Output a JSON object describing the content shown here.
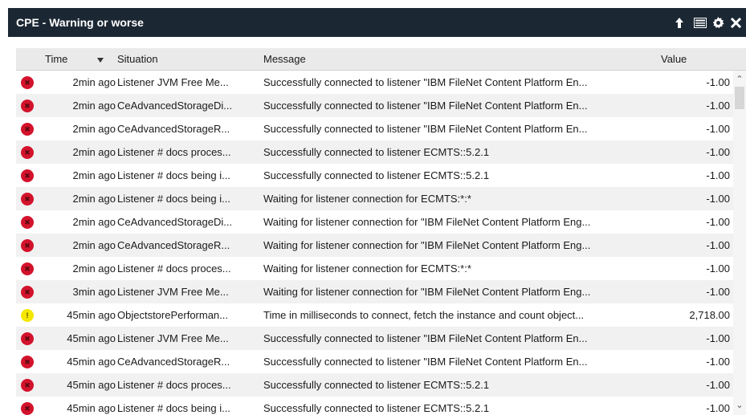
{
  "window": {
    "title": "CPE - Warning or worse"
  },
  "toolbar_icons": [
    "export-icon",
    "table-view-icon",
    "gear-icon",
    "close-icon"
  ],
  "columns": {
    "time": "Time",
    "situation": "Situation",
    "message": "Message",
    "value": "Value"
  },
  "sort": {
    "column": "time",
    "direction": "descending"
  },
  "colors": {
    "titlebar": "#1b2733",
    "critical": "#d3122b",
    "warning": "#f5e700",
    "row_alt": "#f1f1f1",
    "header": "#eaeaea"
  },
  "rows": [
    {
      "severity": "critical",
      "time": "2min ago",
      "situation": "Listener JVM Free Me...",
      "message": "Successfully connected to listener \"IBM FileNet Content Platform En...",
      "value": "-1.00"
    },
    {
      "severity": "critical",
      "time": "2min ago",
      "situation": "CeAdvancedStorageDi...",
      "message": "Successfully connected to listener \"IBM FileNet Content Platform En...",
      "value": "-1.00"
    },
    {
      "severity": "critical",
      "time": "2min ago",
      "situation": "CeAdvancedStorageR...",
      "message": "Successfully connected to listener \"IBM FileNet Content Platform En...",
      "value": "-1.00"
    },
    {
      "severity": "critical",
      "time": "2min ago",
      "situation": "Listener # docs proces...",
      "message": "Successfully connected to listener ECMTS::5.2.1",
      "value": "-1.00"
    },
    {
      "severity": "critical",
      "time": "2min ago",
      "situation": "Listener # docs being i...",
      "message": "Successfully connected to listener ECMTS::5.2.1",
      "value": "-1.00"
    },
    {
      "severity": "critical",
      "time": "2min ago",
      "situation": "Listener # docs being i...",
      "message": "Waiting for listener connection for ECMTS:*:*",
      "value": "-1.00"
    },
    {
      "severity": "critical",
      "time": "2min ago",
      "situation": "CeAdvancedStorageDi...",
      "message": "Waiting for listener connection for \"IBM FileNet Content Platform Eng...",
      "value": "-1.00"
    },
    {
      "severity": "critical",
      "time": "2min ago",
      "situation": "CeAdvancedStorageR...",
      "message": "Waiting for listener connection for \"IBM FileNet Content Platform Eng...",
      "value": "-1.00"
    },
    {
      "severity": "critical",
      "time": "2min ago",
      "situation": "Listener # docs proces...",
      "message": "Waiting for listener connection for ECMTS:*:*",
      "value": "-1.00"
    },
    {
      "severity": "critical",
      "time": "3min ago",
      "situation": "Listener JVM Free Me...",
      "message": "Waiting for listener connection for \"IBM FileNet Content Platform Eng...",
      "value": "-1.00"
    },
    {
      "severity": "warning",
      "time": "45min ago",
      "situation": "ObjectstorePerforman...",
      "message": "Time in milliseconds to connect, fetch the instance and count object...",
      "value": "2,718.00"
    },
    {
      "severity": "critical",
      "time": "45min ago",
      "situation": "Listener JVM Free Me...",
      "message": "Successfully connected to listener \"IBM FileNet Content Platform En...",
      "value": "-1.00"
    },
    {
      "severity": "critical",
      "time": "45min ago",
      "situation": "CeAdvancedStorageR...",
      "message": "Successfully connected to listener \"IBM FileNet Content Platform En...",
      "value": "-1.00"
    },
    {
      "severity": "critical",
      "time": "45min ago",
      "situation": "Listener # docs proces...",
      "message": "Successfully connected to listener ECMTS::5.2.1",
      "value": "-1.00"
    },
    {
      "severity": "critical",
      "time": "45min ago",
      "situation": "Listener # docs being i...",
      "message": "Successfully connected to listener ECMTS::5.2.1",
      "value": "-1.00"
    }
  ]
}
